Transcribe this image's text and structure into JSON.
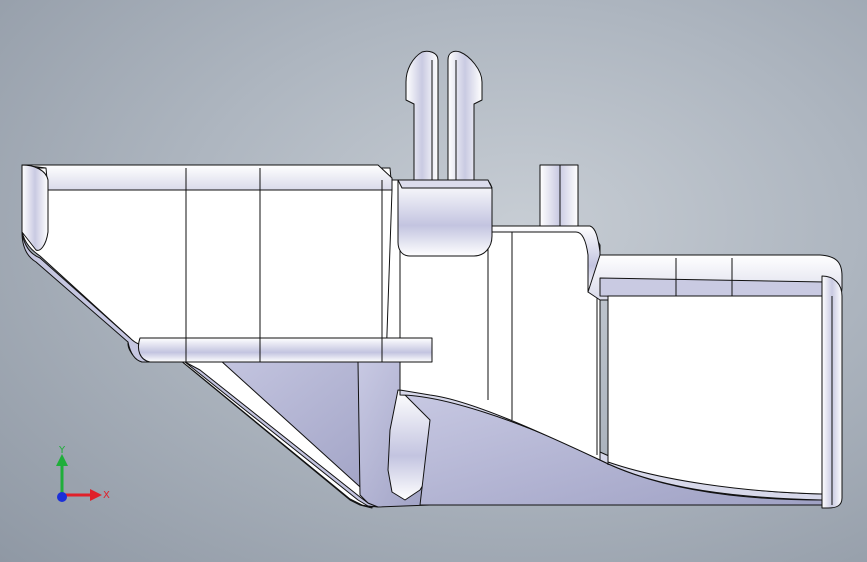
{
  "viewport": {
    "background_top": "#c7cdd4",
    "background_bottom": "#8f98a4"
  },
  "model": {
    "face_color": "#ffffff",
    "edge_color": "#111111",
    "shade_color": "#b8b9d6",
    "dark_shade_color": "#8e90b4"
  },
  "triad": {
    "x_label": "X",
    "y_label": "Y",
    "x_color": "#e0202a",
    "y_color": "#1fae3a",
    "z_color": "#1b2fd8"
  }
}
